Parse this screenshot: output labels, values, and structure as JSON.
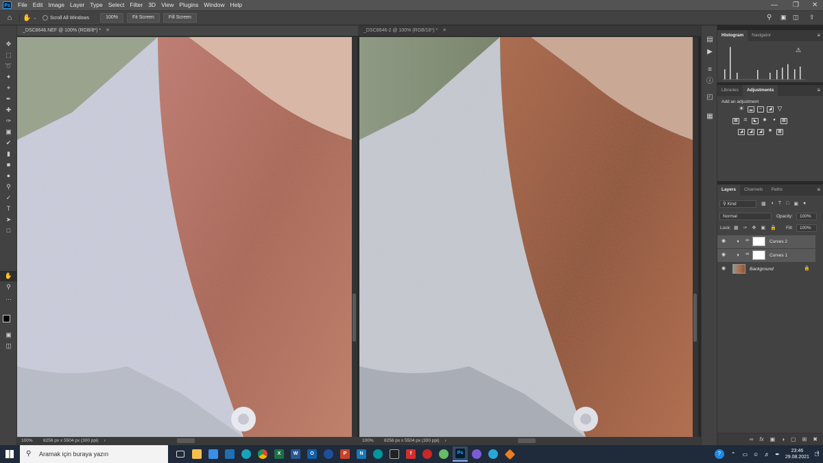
{
  "app": {
    "logo_text": "Ps"
  },
  "menu": [
    "File",
    "Edit",
    "Image",
    "Layer",
    "Type",
    "Select",
    "Filter",
    "3D",
    "View",
    "Plugins",
    "Window",
    "Help"
  ],
  "options_bar": {
    "scroll_all_label": "Scroll All Windows",
    "zoom_btn": "100%",
    "fit_btn": "Fit Screen",
    "fill_btn": "Fill Screen"
  },
  "documents": [
    {
      "tab": "_DSC8646.NEF @ 100% (RGB/8*) *",
      "zoom": "100%",
      "info": "8256 px x 5504 px (300 ppi)"
    },
    {
      "tab": "_DSC8646-2 @ 100% (RGB/16*) *",
      "zoom": "100%",
      "info": "8256 px x 5504 px (300 ppi)"
    }
  ],
  "panels": {
    "top_tabs": [
      "Histogram",
      "Navigator"
    ],
    "mid_tabs": [
      "Libraries",
      "Adjustments"
    ],
    "add_adjustment": "Add an adjustment",
    "layer_tabs": [
      "Layers",
      "Channels",
      "Paths"
    ],
    "kind_filter": "Kind",
    "blend_mode": "Normal",
    "opacity_label": "Opacity:",
    "opacity_value": "100%",
    "lock_label": "Lock:",
    "fill_label": "Fill:",
    "fill_value": "100%",
    "layers": [
      {
        "name": "Curves 2",
        "type": "adjustment"
      },
      {
        "name": "Curves 1",
        "type": "adjustment"
      },
      {
        "name": "Background",
        "type": "image"
      }
    ]
  },
  "histogram_bars": [
    0.3,
    0.95,
    0.2,
    0.28,
    0.2,
    0.28,
    0.35,
    0.45,
    0.3,
    0.38
  ],
  "taskbar": {
    "search_placeholder": "Aramak için buraya yazın",
    "time": "23:46",
    "date": "29.08.2021",
    "notification_count": "2"
  },
  "colors": {
    "accent": "#31a8ff",
    "panel_bg": "#424242",
    "app_bg": "#282828"
  }
}
